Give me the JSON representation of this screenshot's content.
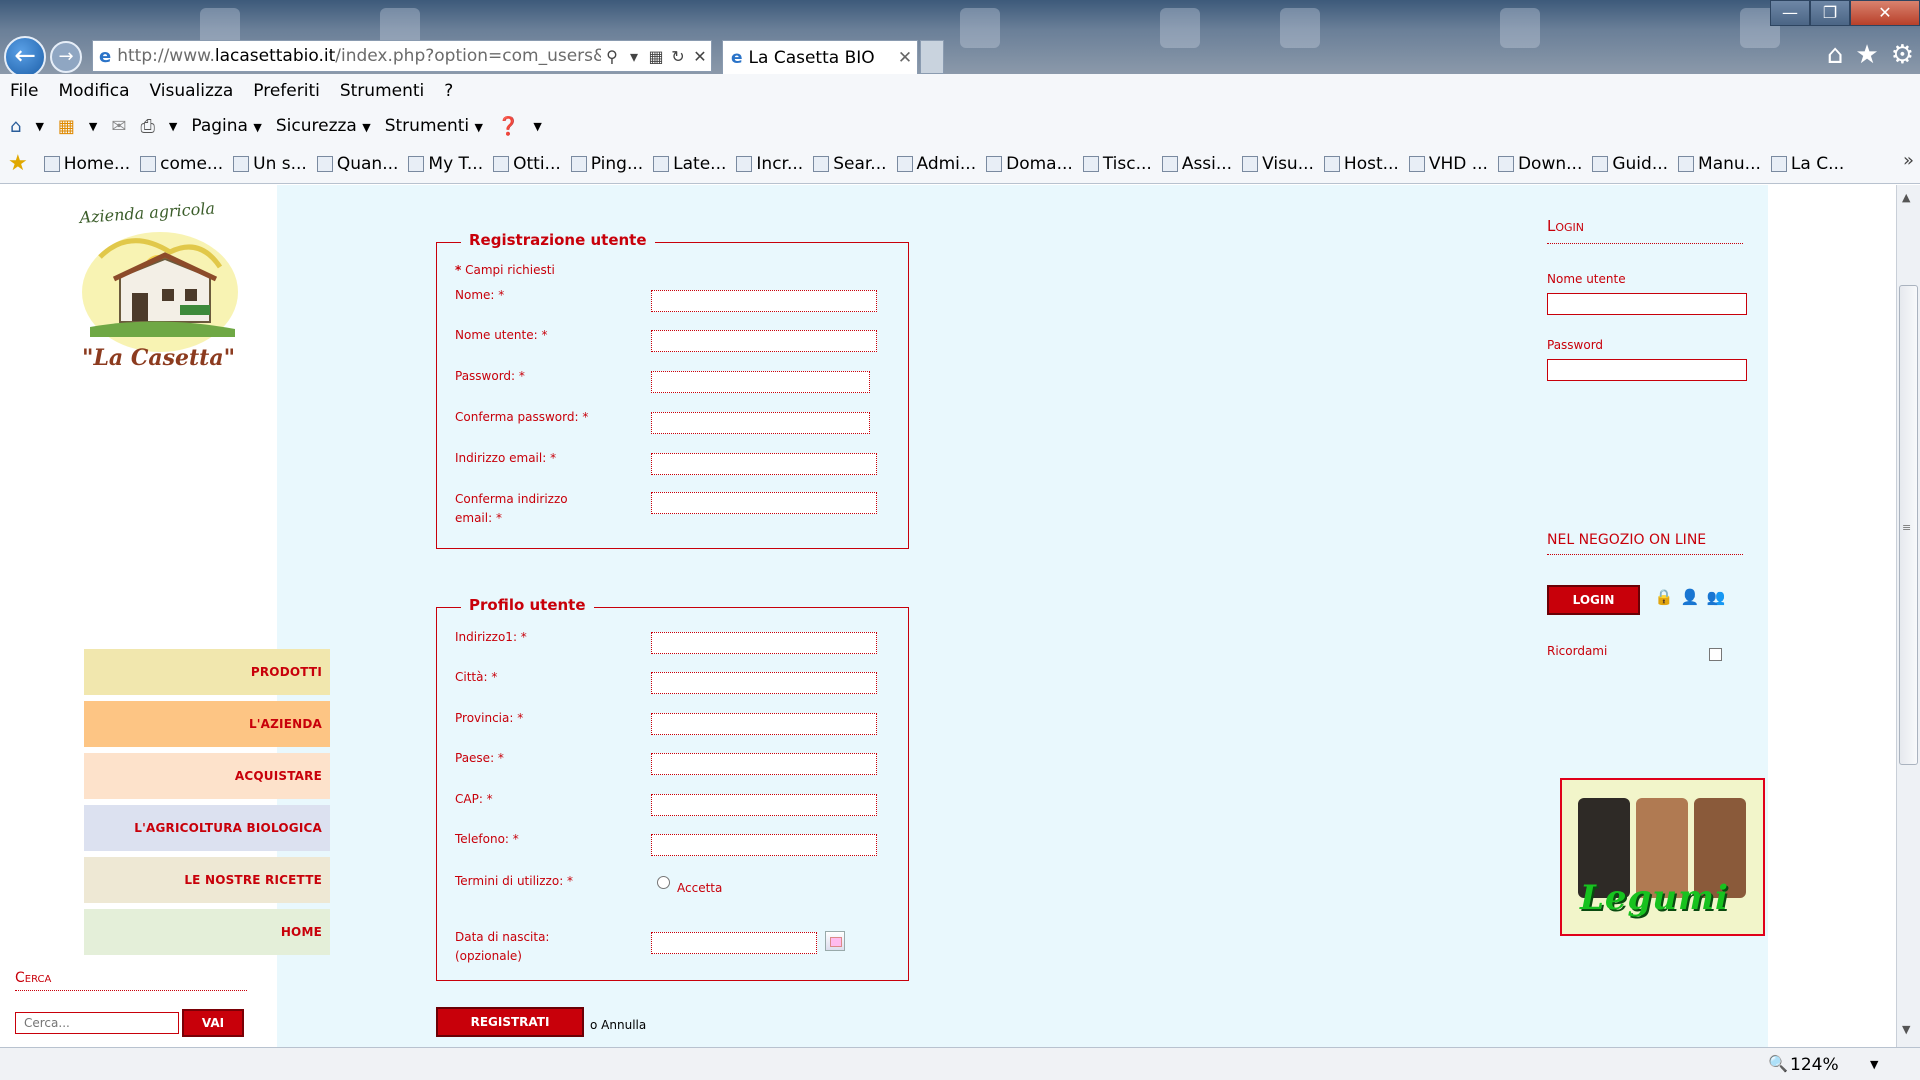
{
  "browser": {
    "url_prefix": "http://www.",
    "url_domain": "lacasettabio.it",
    "url_rest": "/index.php?option=com_users&v",
    "tab_title": "La Casetta BIO",
    "menu": [
      "File",
      "Modifica",
      "Visualizza",
      "Preferiti",
      "Strumenti",
      "?"
    ],
    "commands": [
      "Pagina",
      "Sicurezza",
      "Strumenti"
    ],
    "favorites": [
      "Home...",
      "come...",
      "Un s...",
      "Quan...",
      "My T...",
      "Otti...",
      "Ping...",
      "Late...",
      "Incr...",
      "Sear...",
      "Admi...",
      "Doma...",
      "Tisc...",
      "Assi...",
      "Visu...",
      "Host...",
      "VHD ...",
      "Down...",
      "Guid...",
      "Manu...",
      "La C..."
    ],
    "zoom": "124%"
  },
  "site": {
    "logo": {
      "top_text": "Azienda agricola",
      "name": "\"La Casetta\""
    },
    "nav": [
      {
        "label": "PRODOTTI",
        "color": "#f1e7ae"
      },
      {
        "label": "L'AZIENDA",
        "color": "#fdc584"
      },
      {
        "label": "ACQUISTARE",
        "color": "#fde2cb"
      },
      {
        "label": "L'AGRICOLTURA BIOLOGICA",
        "color": "#dce1f0"
      },
      {
        "label": "LE NOSTRE RICETTE",
        "color": "#eee8d4"
      },
      {
        "label": "HOME",
        "color": "#e4efd9"
      }
    ],
    "search": {
      "title": "Cerca",
      "placeholder": "Cerca...",
      "button": "VAI"
    }
  },
  "registration": {
    "legend": "Registrazione utente",
    "required_star": "*",
    "required_note": "Campi richiesti",
    "fields": [
      "Nome: *",
      "Nome utente: *",
      "Password: *",
      "Conferma password: *",
      "Indirizzo email: *",
      "Conferma indirizzo email: *"
    ]
  },
  "profile": {
    "legend": "Profilo utente",
    "fields": [
      "Indirizzo1: *",
      "Città: *",
      "Provincia: *",
      "Paese: *",
      "CAP: *",
      "Telefono: *"
    ],
    "terms_label": "Termini di utilizzo: *",
    "terms_option": "Accetta",
    "dob_label": "Data di nascita: (opzionale)"
  },
  "actions": {
    "register": "REGISTRATI",
    "or": "o",
    "cancel": "Annulla"
  },
  "login": {
    "title": "Login",
    "username_label": "Nome utente",
    "password_label": "Password",
    "button": "LOGIN",
    "remember_label": "Ricordami"
  },
  "shop": {
    "title": "NEL NEGOZIO ON LINE",
    "banner_text": "Legumi"
  }
}
